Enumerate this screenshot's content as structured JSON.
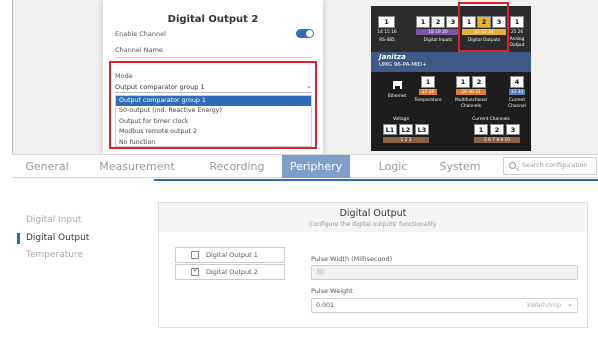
{
  "popup": {
    "title": "Digital Output 2",
    "enable_label": "Enable Channel",
    "channel_name_label": "Channel Name",
    "mode_label": "Mode",
    "mode_value": "Output comparator group 1",
    "mode_options": [
      "Output comparator group 1",
      "S0-output (ind. Reactive Energy)",
      "Output for timer clock",
      "Modbus remote output 2",
      "No function"
    ],
    "toggle_color": "#2e6db5",
    "highlight_color": "#d8232a"
  },
  "device": {
    "brand": "Janitza",
    "model": "UMG 96-PA-MID+",
    "top_terms": {
      "t1": "1",
      "t1_pins": "14 15 16",
      "t1_label": "RS-485",
      "t2a": "1",
      "t2b": "2",
      "t2c": "3",
      "t2_pins": "18 19 20",
      "t2_label": "Digital Inputs",
      "t3a": "1",
      "t3b": "2",
      "t3c": "3",
      "t3_pins": "22 23 24",
      "t3_label": "Digital Outputs",
      "t4": "1",
      "t4_pins": "25 26",
      "t4_label_a": "Analog",
      "t4_label_b": "Output"
    },
    "mid_terms": {
      "eth_label": "Ethernet",
      "temp": "1",
      "temp_pins": "27 28",
      "temp_label": "Temperature",
      "multi_a": "1",
      "multi_b": "2",
      "multi_pins": "29 30 31",
      "multi_label_a": "Multifunctional",
      "multi_label_b": "Channels",
      "cur": "4",
      "cur_pins": "33 34",
      "cur_label_a": "Current",
      "cur_label_b": "Channel"
    },
    "bottom_terms": {
      "voltage_label": "Voltage",
      "l1": "L1",
      "l2": "L2",
      "l3": "L3",
      "v_pins": "1 2 3",
      "currents_label": "Current Channels",
      "c1": "1",
      "c2": "2",
      "c3": "3",
      "c_pins": "5 6 7 8 9 10"
    }
  },
  "tabs": [
    {
      "label": "General"
    },
    {
      "label": "Measurement"
    },
    {
      "label": "Recording"
    },
    {
      "label": "Periphery"
    },
    {
      "label": "Logic"
    },
    {
      "label": "System"
    }
  ],
  "search_placeholder": "Search configuration",
  "sidebar": {
    "items": [
      {
        "label": "Digital Input"
      },
      {
        "label": "Digital Output"
      },
      {
        "label": "Temperature"
      }
    ]
  },
  "panel": {
    "title": "Digital Output",
    "subtitle": "Configure the digital outputs' functionality",
    "outputs": [
      {
        "label": "Digital Output 1",
        "checked": false
      },
      {
        "label": "Digital Output 2",
        "checked": true
      }
    ],
    "pulse_width_label": "Pulse Width (Millisecond)",
    "pulse_width_value": "30",
    "pulse_weight_label": "Pulse Weight",
    "pulse_weight_value": "0.001",
    "pulse_weight_unit": "kWarh/Imp",
    "check_mark": "✓"
  },
  "accent_color": "#2e6db5",
  "active_tab_color": "#7e9fcb"
}
